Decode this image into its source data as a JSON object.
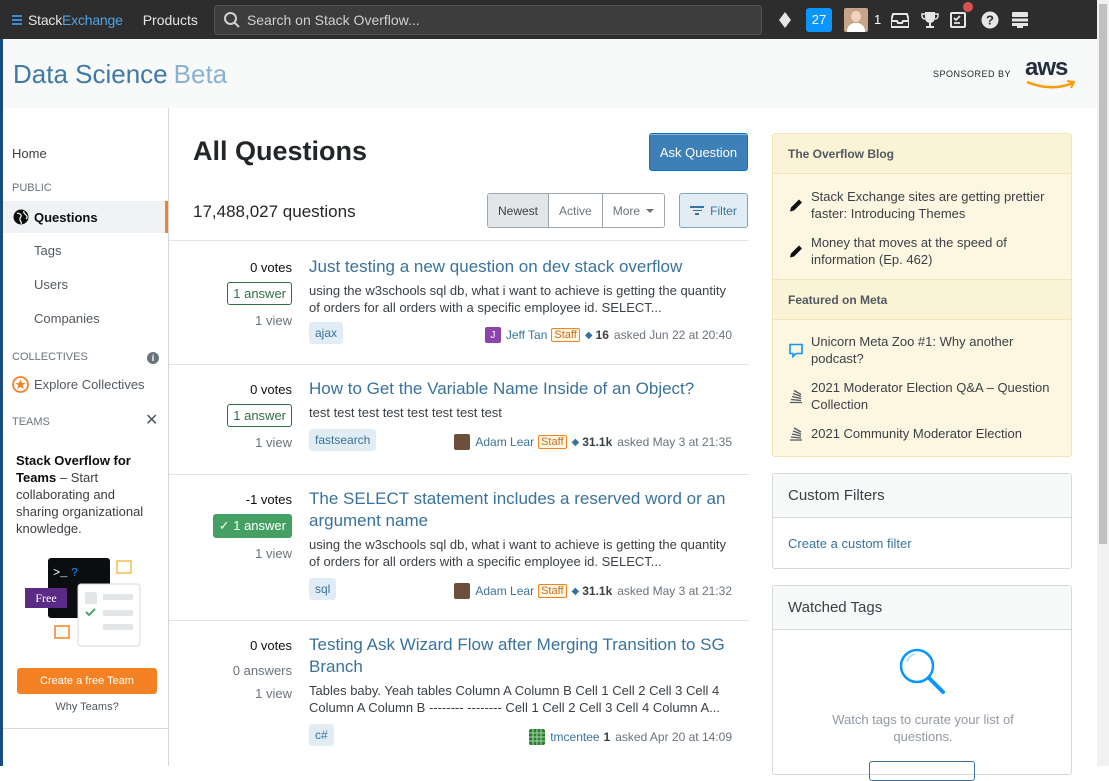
{
  "topbar": {
    "brand_stack": "Stack",
    "brand_exchange": "Exchange",
    "products": "Products",
    "search_placeholder": "Search on Stack Overflow...",
    "rep_count": "27",
    "avatar_rep": "1"
  },
  "header": {
    "site_name": "Data Science",
    "site_beta": "Beta",
    "sponsored_by": "SPONSORED BY",
    "sponsor_logo": "aws"
  },
  "leftnav": {
    "home": "Home",
    "public_heading": "PUBLIC",
    "questions": "Questions",
    "tags": "Tags",
    "users": "Users",
    "companies": "Companies",
    "collectives_heading": "COLLECTIVES",
    "explore_collectives": "Explore Collectives",
    "teams_heading": "TEAMS",
    "teams_title": "Stack Overflow for Teams",
    "teams_desc": " – Start collaborating and sharing organizational knowledge.",
    "free_label": "Free",
    "create_team": "Create a free Team",
    "why_teams": "Why Teams?"
  },
  "main": {
    "title": "All Questions",
    "ask_button": "Ask Question",
    "question_count": "17,488,027 questions",
    "sort": [
      "Newest",
      "Active",
      "More"
    ],
    "filter": "Filter",
    "questions": [
      {
        "votes": "0 votes",
        "answers": "1 answer",
        "views": "1 view",
        "title": "Just testing a new question on dev stack overflow",
        "excerpt": "using the w3schools sql db, what i want to achieve is getting the quantity of orders for all orders with a specific employee id. SELECT...",
        "tag": "ajax",
        "user": "Jeff Tan",
        "staff": "Staff",
        "rep": "16",
        "asked": "asked Jun 22 at 20:40"
      },
      {
        "votes": "0 votes",
        "answers": "1 answer",
        "views": "1 view",
        "title": "How to Get the Variable Name Inside of an Object?",
        "excerpt": "test test test test test test test test",
        "tag": "fastsearch",
        "user": "Adam Lear",
        "staff": "Staff",
        "rep": "31.1k",
        "asked": "asked May 3 at 21:35"
      },
      {
        "votes": "-1 votes",
        "answers": "✓ 1 answer",
        "views": "1 view",
        "title": "The SELECT statement includes a reserved word or an argument name",
        "excerpt": "using the w3schools sql db, what i want to achieve is getting the quantity of orders for all orders with a specific employee id. SELECT...",
        "tag": "sql",
        "user": "Adam Lear",
        "staff": "Staff",
        "rep": "31.1k",
        "asked": "asked May 3 at 21:32"
      },
      {
        "votes": "0 votes",
        "answers": "0 answers",
        "views": "1 view",
        "title": "Testing Ask Wizard Flow after Merging Transition to SG Branch",
        "excerpt": "Tables baby. Yeah tables Column A Column B Cell 1 Cell 2 Cell 3 Cell 4 Column A Column B -------- -------- Cell 1 Cell 2 Cell 3 Cell 4 Column A...",
        "tag": "c#",
        "user": "tmcentee",
        "rep": "1",
        "asked": "asked Apr 20 at 14:09"
      }
    ]
  },
  "sidebar": {
    "blog_heading": "The Overflow Blog",
    "blog_items": [
      "Stack Exchange sites are getting prettier faster: Introducing Themes",
      "Money that moves at the speed of information (Ep. 462)"
    ],
    "meta_heading": "Featured on Meta",
    "meta_items": [
      "Unicorn Meta Zoo #1: Why another podcast?",
      "2021 Moderator Election Q&A – Question Collection",
      "2021 Community Moderator Election"
    ],
    "custom_filters_heading": "Custom Filters",
    "create_filter": "Create a custom filter",
    "watched_tags_heading": "Watched Tags",
    "watched_tags_text": "Watch tags to curate your list of questions."
  }
}
